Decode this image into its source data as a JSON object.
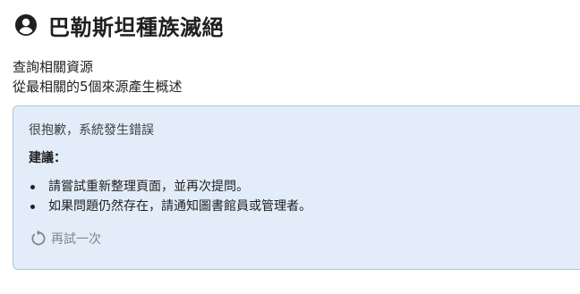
{
  "header": {
    "title": "巴勒斯坦種族滅絕",
    "icon": "account-circle-icon"
  },
  "subtitle": {
    "line1": "查詢相關資源",
    "line2": "從最相關的5個來源產生概述"
  },
  "error_card": {
    "title": "很抱歉，系統發生錯誤",
    "suggestion_label": "建議：",
    "suggestions": [
      "請嘗試重新整理頁面，並再次提問。",
      "如果問題仍然存在，請通知圖書館員或管理者。"
    ],
    "retry_label": "再試一次",
    "retry_icon": "refresh-icon",
    "background_color": "#e3edf9",
    "border_color": "#a9c6e8"
  }
}
